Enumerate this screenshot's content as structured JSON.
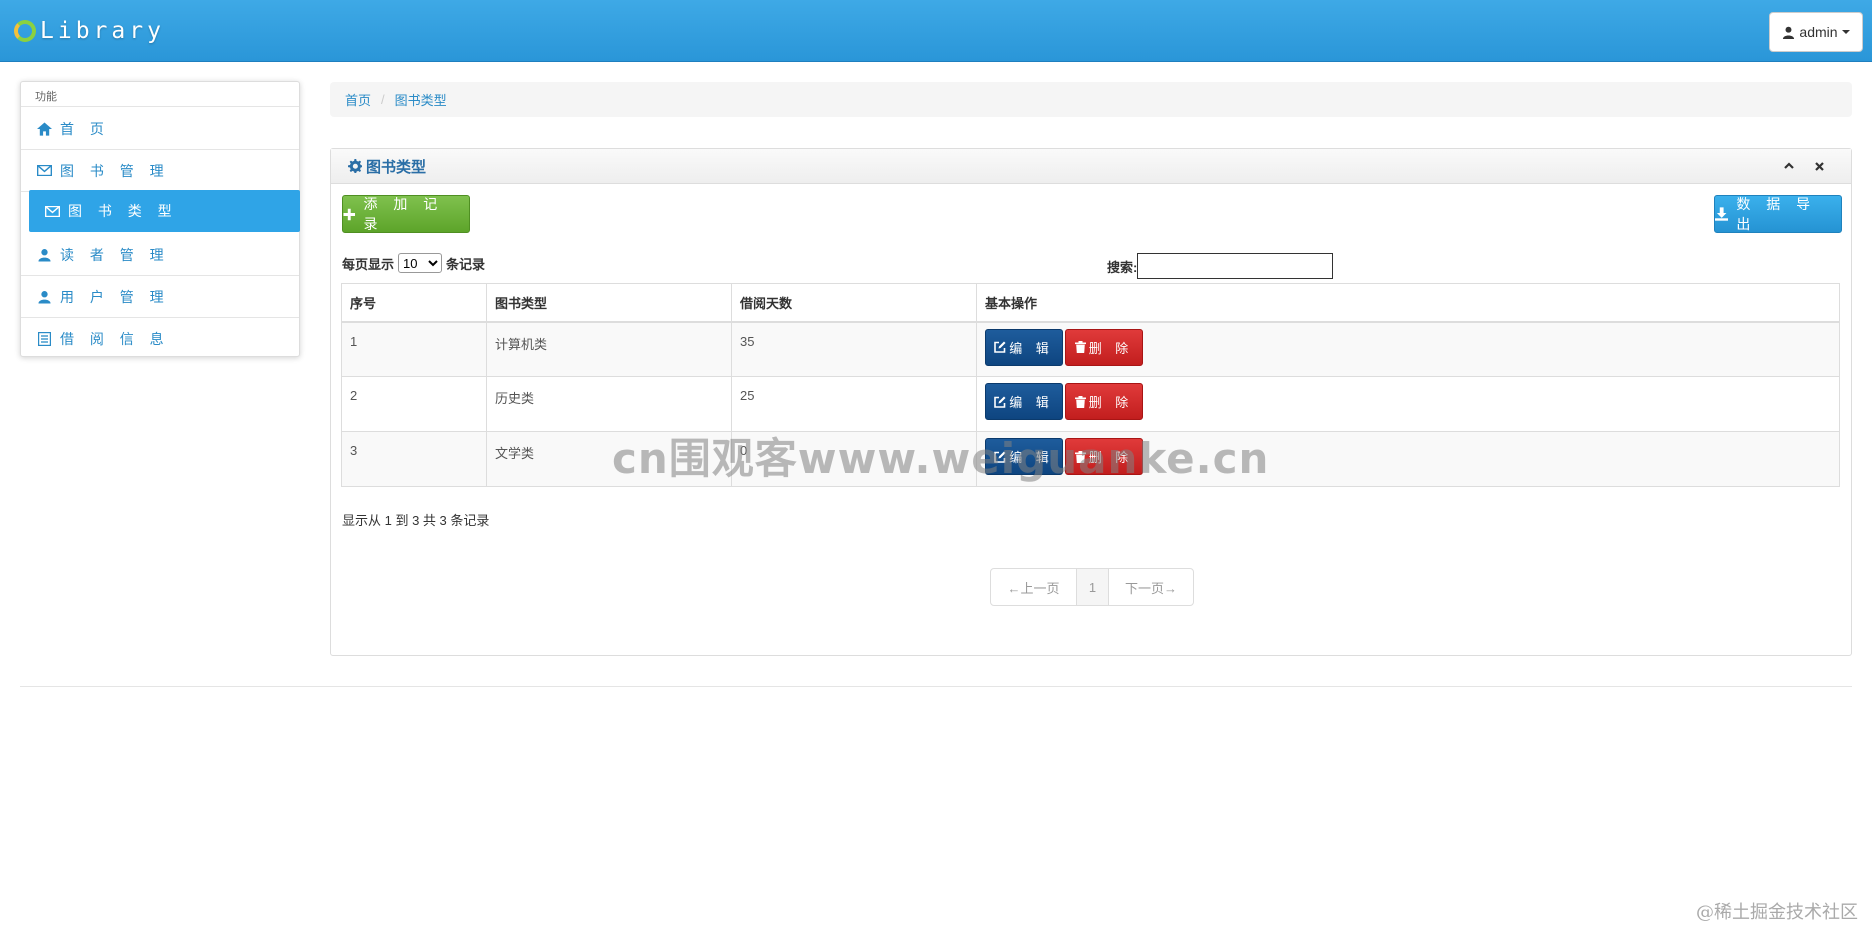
{
  "app": {
    "brand": "Library",
    "user": "admin"
  },
  "sidebar": {
    "header": "功能",
    "items": [
      {
        "label": "首 页",
        "icon": "home-icon"
      },
      {
        "label": "图 书 管 理",
        "icon": "envelope-icon"
      },
      {
        "label": "图 书 类 型",
        "icon": "envelope-icon",
        "active": true
      },
      {
        "label": "读 者 管 理",
        "icon": "user-icon"
      },
      {
        "label": "用 户 管 理",
        "icon": "user-icon"
      },
      {
        "label": "借 阅 信 息",
        "icon": "list-icon"
      }
    ]
  },
  "breadcrumb": {
    "home": "首页",
    "current": "图书类型"
  },
  "panel": {
    "title": "图书类型",
    "add_label": "添 加 记 录",
    "export_label": "数 据 导 出",
    "length_prefix": "每页显示",
    "length_value": "10",
    "length_suffix": "条记录",
    "search_label": "搜索:",
    "search_value": ""
  },
  "table": {
    "headers": [
      "序号",
      "图书类型",
      "借阅天数",
      "基本操作"
    ],
    "rows": [
      {
        "id": "1",
        "type": "计算机类",
        "days": "35"
      },
      {
        "id": "2",
        "type": "历史类",
        "days": "25"
      },
      {
        "id": "3",
        "type": "文学类",
        "days": "0"
      }
    ],
    "edit_label": "编 辑",
    "delete_label": "删 除"
  },
  "info": "显示从 1 到 3 共 3 条记录",
  "pager": {
    "prev": "←上一页",
    "page": "1",
    "next": "下一页→"
  },
  "watermark": "cn围观客www.weiguanke.cn",
  "footer_mark": "@稀土掘金技术社区",
  "colors": {
    "topbar": "#2fa4e7",
    "active": "#2fa4e7",
    "add": "#6bb13a",
    "edit": "#134f8e",
    "delete": "#d22a2a"
  }
}
